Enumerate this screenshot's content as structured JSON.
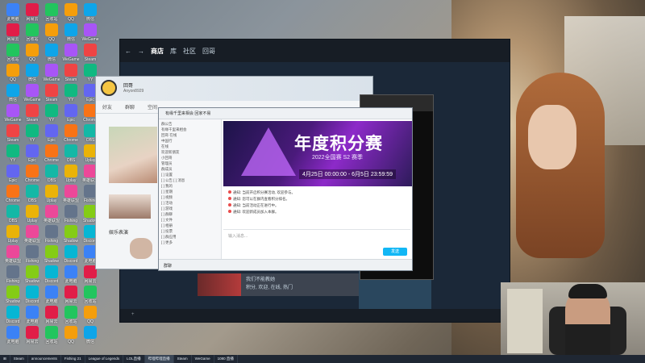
{
  "steam": {
    "nav": [
      "商店",
      "库",
      "社区",
      "回哥"
    ],
    "active_tab": "商店",
    "thumb_title": "我们不能教她",
    "thumb_sub": "积分, 欢迎, 在线, 热门"
  },
  "qq_profile": {
    "name": "回哥",
    "sub": "Anyon8929",
    "tabs": [
      "好友",
      "群聊",
      "空间"
    ],
    "section": "娱乐表演"
  },
  "chat": {
    "title": "有缘千里来相会 回家不易",
    "banner_title": "年度积分赛",
    "banner_sub": "2022全国赛 S2 赛季",
    "banner_date": "4月25日 00:00:00 - 6月5日 23:59:59",
    "left_items": [
      "群公告",
      "有缘千里来相会",
      "回哥 在线",
      "中国行",
      "在线",
      "欢迎新朋友",
      "小回哥",
      "管理员",
      "群成员",
      "[ ] 设置",
      "[ ] 公告 [ ] 消息",
      "[ ] 我的",
      "[ ] 星期",
      "[ ] 视频",
      "[ ] 活动",
      "[ ] 游戏",
      "[ ] 群聊",
      "[ ] 文件",
      "[ ] 相册",
      "[ ] 投票",
      "[ ] 群应用",
      "[ ] 更多"
    ],
    "messages": [
      "通知: 当前开启积分赛活动, 欢迎参与。",
      "通知: 您可以在群内查看积分排名。",
      "通知: 当前活动正在进行中。",
      "通知: 欢迎新成员加入本群。"
    ],
    "input_placeholder": "输入消息...",
    "bottom_left": "群聊",
    "send": "发送"
  },
  "taskbar": {
    "items": [
      "Steam",
      "announcements",
      "Fishing 21",
      "League of Legends",
      "LOL直播",
      "哔哩哔哩直播",
      "Steam",
      "WeGame",
      "1080 直播"
    ]
  },
  "desktop_icons": [
    "此电脑",
    "网易云",
    "回收站",
    "QQ",
    "微信",
    "WeGame",
    "Steam",
    "YY",
    "Epic",
    "Chrome",
    "OBS",
    "Uplay",
    "英雄联盟",
    "Fishing",
    "Shadow",
    "Discord"
  ]
}
